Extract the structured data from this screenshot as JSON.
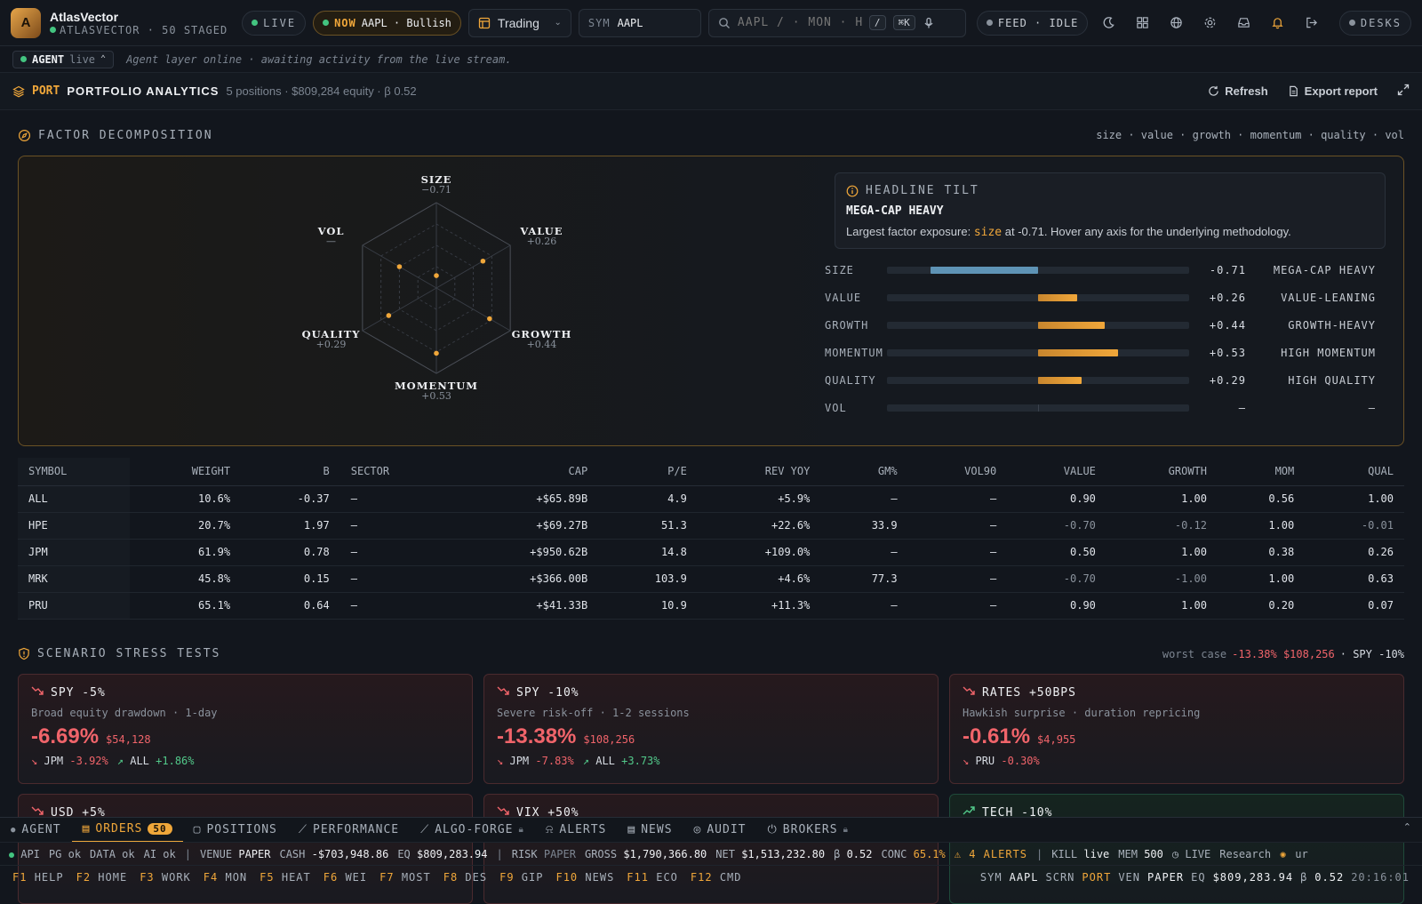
{
  "app": {
    "name": "AtlasVector",
    "sub": "ATLASVECTOR · 50 STAGED",
    "logo_letter": "A"
  },
  "top": {
    "live": "LIVE",
    "now_label": "NOW",
    "now_text": "AAPL · Bullish",
    "workspace": "Trading",
    "sym_label": "SYM",
    "sym_value": "AAPL",
    "search_placeholder": "AAPL / · MON · HE",
    "search_kbd1": "/",
    "search_kbd2": "⌘K",
    "feed": "FEED · IDLE",
    "desks": "DESKS"
  },
  "agent": {
    "label": "AGENT",
    "state": "live",
    "message": "Agent layer online · awaiting activity from the live stream."
  },
  "port": {
    "tag": "PORT",
    "title": "PORTFOLIO ANALYTICS",
    "summary": "5 positions · $809,284 equity · β 0.52",
    "refresh": "Refresh",
    "export": "Export report"
  },
  "factor": {
    "title": "FACTOR DECOMPOSITION",
    "right": "size · value · growth · momentum · quality · vol",
    "axes": [
      {
        "name": "SIZE",
        "value": "−0.71",
        "num": -0.71
      },
      {
        "name": "VALUE",
        "value": "+0.26",
        "num": 0.26
      },
      {
        "name": "GROWTH",
        "value": "+0.44",
        "num": 0.44
      },
      {
        "name": "MOMENTUM",
        "value": "+0.53",
        "num": 0.53
      },
      {
        "name": "QUALITY",
        "value": "+0.29",
        "num": 0.29
      },
      {
        "name": "VOL",
        "value": "—",
        "num": 0
      }
    ],
    "tilt_title": "HEADLINE TILT",
    "tilt_head": "MEGA-CAP HEAVY",
    "tilt_pre": "Largest factor exposure: ",
    "tilt_factor": "size",
    "tilt_post": " at -0.71. Hover any axis for the underlying methodology.",
    "bars": [
      {
        "label": "SIZE",
        "value": "-0.71",
        "num": -0.71,
        "tag": "MEGA-CAP HEAVY"
      },
      {
        "label": "VALUE",
        "value": "+0.26",
        "num": 0.26,
        "tag": "VALUE-LEANING"
      },
      {
        "label": "GROWTH",
        "value": "+0.44",
        "num": 0.44,
        "tag": "GROWTH-HEAVY"
      },
      {
        "label": "MOMENTUM",
        "value": "+0.53",
        "num": 0.53,
        "tag": "HIGH MOMENTUM"
      },
      {
        "label": "QUALITY",
        "value": "+0.29",
        "num": 0.29,
        "tag": "HIGH QUALITY"
      },
      {
        "label": "VOL",
        "value": "—",
        "num": 0,
        "tag": "—"
      }
    ]
  },
  "table": {
    "headers": [
      "SYMBOL",
      "WEIGHT",
      "Β",
      "SECTOR",
      "CAP",
      "P/E",
      "REV YOY",
      "GM%",
      "VOL90",
      "VALUE",
      "GROWTH",
      "MOM",
      "QUAL"
    ],
    "rows": [
      [
        "ALL",
        "10.6%",
        "-0.37",
        "—",
        "+$65.89B",
        "4.9",
        "+5.9%",
        "—",
        "—",
        "0.90",
        "1.00",
        "0.56",
        "1.00"
      ],
      [
        "HPE",
        "20.7%",
        "1.97",
        "—",
        "+$69.27B",
        "51.3",
        "+22.6%",
        "33.9",
        "—",
        "-0.70",
        "-0.12",
        "1.00",
        "-0.01"
      ],
      [
        "JPM",
        "61.9%",
        "0.78",
        "—",
        "+$950.62B",
        "14.8",
        "+109.0%",
        "—",
        "—",
        "0.50",
        "1.00",
        "0.38",
        "0.26"
      ],
      [
        "MRK",
        "45.8%",
        "0.15",
        "—",
        "+$366.00B",
        "103.9",
        "+4.6%",
        "77.3",
        "—",
        "-0.70",
        "-1.00",
        "1.00",
        "0.63"
      ],
      [
        "PRU",
        "65.1%",
        "0.64",
        "—",
        "+$41.33B",
        "10.9",
        "+11.3%",
        "—",
        "—",
        "0.90",
        "1.00",
        "0.20",
        "0.07"
      ]
    ]
  },
  "stress": {
    "title": "SCENARIO STRESS TESTS",
    "worst_label": "worst case",
    "worst_value": "-13.38% $108,256",
    "worst_scn": "· SPY -10%",
    "cards": [
      {
        "title": "SPY -5%",
        "desc": "Broad equity drawdown · 1-day",
        "pct": "-6.69%",
        "usd": "$54,128",
        "m1s": "JPM",
        "m1v": "-3.92%",
        "m2s": "ALL",
        "m2v": "+1.86%"
      },
      {
        "title": "SPY -10%",
        "desc": "Severe risk-off · 1-2 sessions",
        "pct": "-13.38%",
        "usd": "$108,256",
        "m1s": "JPM",
        "m1v": "-7.83%",
        "m2s": "ALL",
        "m2v": "+3.73%"
      },
      {
        "title": "RATES +50BPS",
        "desc": "Hawkish surprise · duration repricing",
        "pct": "-0.61%",
        "usd": "$4,955",
        "m1s": "PRU",
        "m1v": "-0.30%",
        "m2s": "",
        "m2v": ""
      },
      {
        "title": "USD +5%"
      },
      {
        "title": "VIX +50%"
      },
      {
        "title": "TECH -10%"
      }
    ]
  },
  "tabs": [
    {
      "label": "AGENT"
    },
    {
      "label": "ORDERS",
      "badge": "50"
    },
    {
      "label": "POSITIONS"
    },
    {
      "label": "PERFORMANCE"
    },
    {
      "label": "ALGO-FORGE"
    },
    {
      "label": "ALERTS"
    },
    {
      "label": "NEWS"
    },
    {
      "label": "AUDIT"
    },
    {
      "label": "BROKERS"
    }
  ],
  "status": {
    "api": "API",
    "pg": "PG ok",
    "data": "DATA ok",
    "ai": "AI ok",
    "venue_l": "VENUE",
    "venue": "PAPER",
    "cash_l": "CASH",
    "cash": "-$703,948.86",
    "eq_l": "EQ",
    "eq": "$809,283.94",
    "risk_l": "RISK",
    "risk": "PAPER",
    "gross_l": "GROSS",
    "gross": "$1,790,366.80",
    "net_l": "NET",
    "net": "$1,513,232.80",
    "beta_l": "β",
    "beta": "0.52",
    "conc_l": "CONC",
    "conc": "65.1%",
    "alerts": "⚠ 4 ALERTS",
    "kill_l": "KILL",
    "kill": "live",
    "mem_l": "MEM",
    "mem": "500",
    "live": "LIVE",
    "research": "Research",
    "ur": "ur"
  },
  "fkeys": [
    {
      "k": "F1",
      "l": "HELP"
    },
    {
      "k": "F2",
      "l": "HOME"
    },
    {
      "k": "F3",
      "l": "WORK"
    },
    {
      "k": "F4",
      "l": "MON"
    },
    {
      "k": "F5",
      "l": "HEAT"
    },
    {
      "k": "F6",
      "l": "WEI"
    },
    {
      "k": "F7",
      "l": "MOST"
    },
    {
      "k": "F8",
      "l": "DES"
    },
    {
      "k": "F9",
      "l": "GIP"
    },
    {
      "k": "F10",
      "l": "NEWS"
    },
    {
      "k": "F11",
      "l": "ECO"
    },
    {
      "k": "F12",
      "l": "CMD"
    }
  ],
  "fright": {
    "sym_l": "SYM",
    "sym": "AAPL",
    "scrn_l": "SCRN",
    "scrn": "PORT",
    "ven_l": "VEN",
    "ven": "PAPER",
    "eq_l": "EQ",
    "eq": "$809,283.94",
    "b_l": "β",
    "b": "0.52",
    "time": "20:16:01"
  }
}
